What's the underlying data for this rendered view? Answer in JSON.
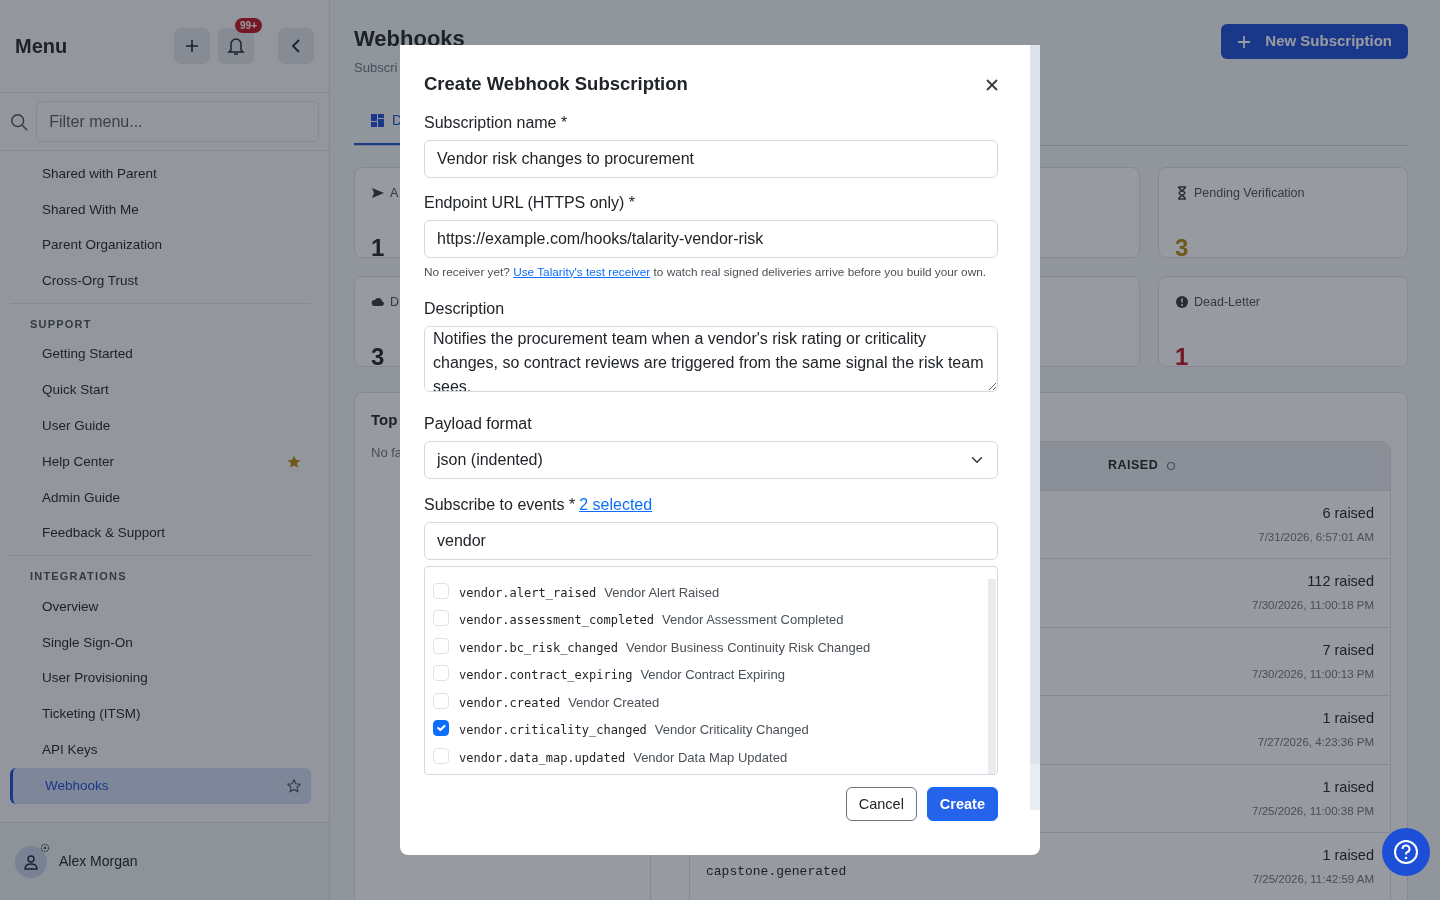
{
  "sidebar": {
    "title": "Menu",
    "notification_count": "99+",
    "filter_placeholder": "Filter menu...",
    "sections": [
      {
        "items": [
          {
            "label": "Shared with Parent",
            "selected": false,
            "starred": false
          },
          {
            "label": "Shared With Me",
            "selected": false,
            "starred": false
          },
          {
            "label": "Parent Organization",
            "selected": false,
            "starred": false
          },
          {
            "label": "Cross-Org Trust",
            "selected": false,
            "starred": false
          }
        ]
      },
      {
        "heading": "SUPPORT",
        "items": [
          {
            "label": "Getting Started",
            "selected": false,
            "starred": false
          },
          {
            "label": "Quick Start",
            "selected": false,
            "starred": false
          },
          {
            "label": "User Guide",
            "selected": false,
            "starred": false
          },
          {
            "label": "Help Center",
            "selected": false,
            "starred": true
          },
          {
            "label": "Admin Guide",
            "selected": false,
            "starred": false
          },
          {
            "label": "Feedback & Support",
            "selected": false,
            "starred": false
          }
        ]
      },
      {
        "heading": "INTEGRATIONS",
        "items": [
          {
            "label": "Overview",
            "selected": false,
            "starred": false
          },
          {
            "label": "Single Sign-On",
            "selected": false,
            "starred": false
          },
          {
            "label": "User Provisioning",
            "selected": false,
            "starred": false
          },
          {
            "label": "Ticketing (ITSM)",
            "selected": false,
            "starred": false
          },
          {
            "label": "API Keys",
            "selected": false,
            "starred": false
          },
          {
            "label": "Webhooks",
            "selected": true,
            "starred": false
          }
        ]
      }
    ],
    "user": {
      "name": "Alex Morgan"
    }
  },
  "page": {
    "title": "Webhooks",
    "subtitle": "Subscri",
    "new_button": "New Subscription",
    "tabs": [
      {
        "label": "D",
        "selected": true
      }
    ],
    "stats": [
      {
        "label": "A",
        "value": "1",
        "kind": "neutral"
      },
      {
        "label": "Pending Verification",
        "value": "3",
        "kind": "warning"
      },
      {
        "label": "D",
        "value": "3",
        "kind": "neutral"
      },
      {
        "label": "Dead-Letter",
        "value": "1",
        "kind": "danger"
      }
    ],
    "panel": {
      "title": "Top",
      "text": "No fa"
    },
    "table": {
      "columns": [
        "RAISED"
      ],
      "rows": [
        {
          "raised": "6 raised",
          "time": "7/31/2026, 6:57:01 AM"
        },
        {
          "raised": "112 raised",
          "time": "7/30/2026, 11:00:18 PM"
        },
        {
          "raised": "7 raised",
          "time": "7/30/2026, 11:00:13 PM"
        },
        {
          "raised": "1 raised",
          "time": "7/27/2026, 4:23:36 PM"
        },
        {
          "raised": "1 raised",
          "time": "7/25/2026, 11:00:38 PM"
        },
        {
          "event": "capstone.generated",
          "raised": "1 raised",
          "time": "7/25/2026, 11:42:59 AM"
        }
      ]
    }
  },
  "dialog": {
    "title": "Create Webhook Subscription",
    "name_label": "Subscription name *",
    "name_value": "Vendor risk changes to procurement",
    "url_label": "Endpoint URL (HTTPS only) *",
    "url_value": "https://example.com/hooks/talarity-vendor-risk",
    "help_before": "No receiver yet? ",
    "help_link": "Use Talarity's test receiver",
    "help_after": " to watch real signed deliveries arrive before you build your own.",
    "description_label": "Description",
    "description_value": "Notifies the procurement team when a vendor's risk rating or criticality changes, so contract reviews are triggered from the same signal the risk team sees.",
    "format_label": "Payload format",
    "format_value": "json (indented)",
    "events_label": "Subscribe to events *",
    "events_count": "2 selected",
    "events_search": "vendor",
    "events": [
      {
        "code": "vendor.alert_raised",
        "name": "Vendor Alert Raised",
        "checked": false
      },
      {
        "code": "vendor.assessment_completed",
        "name": "Vendor Assessment Completed",
        "checked": false
      },
      {
        "code": "vendor.bc_risk_changed",
        "name": "Vendor Business Continuity Risk Changed",
        "checked": false
      },
      {
        "code": "vendor.contract_expiring",
        "name": "Vendor Contract Expiring",
        "checked": false
      },
      {
        "code": "vendor.created",
        "name": "Vendor Created",
        "checked": false
      },
      {
        "code": "vendor.criticality_changed",
        "name": "Vendor Criticality Changed",
        "checked": true
      },
      {
        "code": "vendor.data_map.updated",
        "name": "Vendor Data Map Updated",
        "checked": false
      }
    ],
    "cancel": "Cancel",
    "create": "Create"
  }
}
